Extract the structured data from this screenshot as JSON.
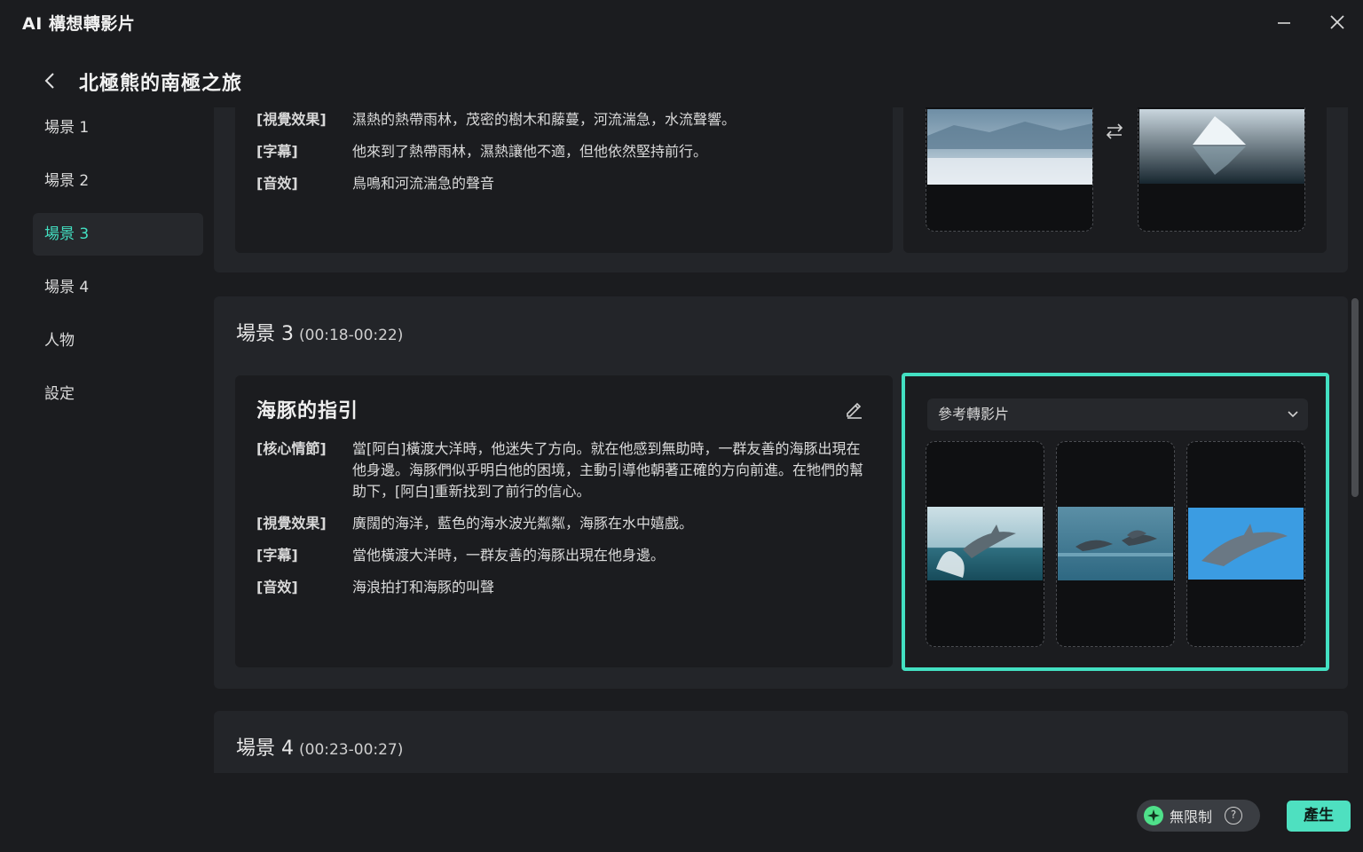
{
  "window": {
    "title": "AI 構想轉影片"
  },
  "header": {
    "title": "北極熊的南極之旅"
  },
  "sidebar": {
    "items": [
      {
        "label": "場景 1"
      },
      {
        "label": "場景 2"
      },
      {
        "label": "場景 3",
        "active": true
      },
      {
        "label": "場景 4"
      },
      {
        "label": "人物"
      },
      {
        "label": "設定"
      }
    ]
  },
  "scene2": {
    "rows": [
      {
        "label": "[視覺效果]",
        "value": "濕熱的熱帶雨林，茂密的樹木和藤蔓，河流湍急，水流聲響。"
      },
      {
        "label": "[字幕]",
        "value": "他來到了熱帶雨林，濕熱讓他不適，但他依然堅持前行。"
      },
      {
        "label": "[音效]",
        "value": "鳥鳴和河流湍急的聲音"
      }
    ],
    "images": [
      {
        "icon": "glacier-landscape-image"
      },
      {
        "icon": "iceberg-reflection-image"
      }
    ],
    "swap_icon": "swap-arrows-icon"
  },
  "scene3": {
    "heading": "場景 3",
    "time": "(00:18-00:22)",
    "title": "海豚的指引",
    "rows": [
      {
        "label": "[核心情節]",
        "value": "當[阿白]橫渡大洋時，他迷失了方向。就在他感到無助時，一群友善的海豚出現在他身邊。海豚們似乎明白他的困境，主動引導他朝著正確的方向前進。在牠們的幫助下，[阿白]重新找到了前行的信心。"
      },
      {
        "label": "[視覺效果]",
        "value": "廣闊的海洋，藍色的海水波光粼粼，海豚在水中嬉戲。"
      },
      {
        "label": "[字幕]",
        "value": "當他橫渡大洋時，一群友善的海豚出現在他身邊。"
      },
      {
        "label": "[音效]",
        "value": "海浪拍打和海豚的叫聲"
      }
    ],
    "select": {
      "value": "參考轉影片"
    },
    "images": [
      {
        "icon": "dolphin-jumping-image"
      },
      {
        "icon": "dolphins-swimming-image"
      },
      {
        "icon": "dolphin-blue-water-image"
      }
    ]
  },
  "scene4": {
    "heading": "場景 4",
    "time": "(00:23-00:27)"
  },
  "footer": {
    "badge_label": "無限制",
    "badge_help": "?",
    "generate_label": "產生"
  },
  "colors": {
    "accent": "#43e0c2",
    "button": "#4ee0c0",
    "background": "#1b1c1f",
    "panel": "#232529"
  }
}
